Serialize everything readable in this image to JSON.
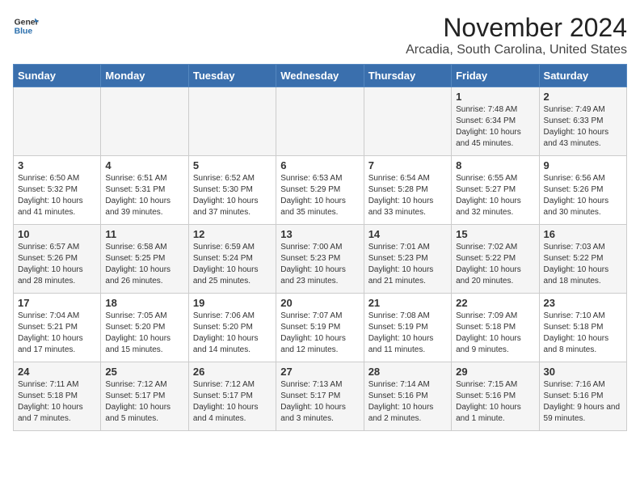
{
  "logo": {
    "line1": "General",
    "line2": "Blue"
  },
  "title": "November 2024",
  "location": "Arcadia, South Carolina, United States",
  "weekdays": [
    "Sunday",
    "Monday",
    "Tuesday",
    "Wednesday",
    "Thursday",
    "Friday",
    "Saturday"
  ],
  "weeks": [
    [
      {
        "day": "",
        "info": ""
      },
      {
        "day": "",
        "info": ""
      },
      {
        "day": "",
        "info": ""
      },
      {
        "day": "",
        "info": ""
      },
      {
        "day": "",
        "info": ""
      },
      {
        "day": "1",
        "info": "Sunrise: 7:48 AM\nSunset: 6:34 PM\nDaylight: 10 hours and 45 minutes."
      },
      {
        "day": "2",
        "info": "Sunrise: 7:49 AM\nSunset: 6:33 PM\nDaylight: 10 hours and 43 minutes."
      }
    ],
    [
      {
        "day": "3",
        "info": "Sunrise: 6:50 AM\nSunset: 5:32 PM\nDaylight: 10 hours and 41 minutes."
      },
      {
        "day": "4",
        "info": "Sunrise: 6:51 AM\nSunset: 5:31 PM\nDaylight: 10 hours and 39 minutes."
      },
      {
        "day": "5",
        "info": "Sunrise: 6:52 AM\nSunset: 5:30 PM\nDaylight: 10 hours and 37 minutes."
      },
      {
        "day": "6",
        "info": "Sunrise: 6:53 AM\nSunset: 5:29 PM\nDaylight: 10 hours and 35 minutes."
      },
      {
        "day": "7",
        "info": "Sunrise: 6:54 AM\nSunset: 5:28 PM\nDaylight: 10 hours and 33 minutes."
      },
      {
        "day": "8",
        "info": "Sunrise: 6:55 AM\nSunset: 5:27 PM\nDaylight: 10 hours and 32 minutes."
      },
      {
        "day": "9",
        "info": "Sunrise: 6:56 AM\nSunset: 5:26 PM\nDaylight: 10 hours and 30 minutes."
      }
    ],
    [
      {
        "day": "10",
        "info": "Sunrise: 6:57 AM\nSunset: 5:26 PM\nDaylight: 10 hours and 28 minutes."
      },
      {
        "day": "11",
        "info": "Sunrise: 6:58 AM\nSunset: 5:25 PM\nDaylight: 10 hours and 26 minutes."
      },
      {
        "day": "12",
        "info": "Sunrise: 6:59 AM\nSunset: 5:24 PM\nDaylight: 10 hours and 25 minutes."
      },
      {
        "day": "13",
        "info": "Sunrise: 7:00 AM\nSunset: 5:23 PM\nDaylight: 10 hours and 23 minutes."
      },
      {
        "day": "14",
        "info": "Sunrise: 7:01 AM\nSunset: 5:23 PM\nDaylight: 10 hours and 21 minutes."
      },
      {
        "day": "15",
        "info": "Sunrise: 7:02 AM\nSunset: 5:22 PM\nDaylight: 10 hours and 20 minutes."
      },
      {
        "day": "16",
        "info": "Sunrise: 7:03 AM\nSunset: 5:22 PM\nDaylight: 10 hours and 18 minutes."
      }
    ],
    [
      {
        "day": "17",
        "info": "Sunrise: 7:04 AM\nSunset: 5:21 PM\nDaylight: 10 hours and 17 minutes."
      },
      {
        "day": "18",
        "info": "Sunrise: 7:05 AM\nSunset: 5:20 PM\nDaylight: 10 hours and 15 minutes."
      },
      {
        "day": "19",
        "info": "Sunrise: 7:06 AM\nSunset: 5:20 PM\nDaylight: 10 hours and 14 minutes."
      },
      {
        "day": "20",
        "info": "Sunrise: 7:07 AM\nSunset: 5:19 PM\nDaylight: 10 hours and 12 minutes."
      },
      {
        "day": "21",
        "info": "Sunrise: 7:08 AM\nSunset: 5:19 PM\nDaylight: 10 hours and 11 minutes."
      },
      {
        "day": "22",
        "info": "Sunrise: 7:09 AM\nSunset: 5:18 PM\nDaylight: 10 hours and 9 minutes."
      },
      {
        "day": "23",
        "info": "Sunrise: 7:10 AM\nSunset: 5:18 PM\nDaylight: 10 hours and 8 minutes."
      }
    ],
    [
      {
        "day": "24",
        "info": "Sunrise: 7:11 AM\nSunset: 5:18 PM\nDaylight: 10 hours and 7 minutes."
      },
      {
        "day": "25",
        "info": "Sunrise: 7:12 AM\nSunset: 5:17 PM\nDaylight: 10 hours and 5 minutes."
      },
      {
        "day": "26",
        "info": "Sunrise: 7:12 AM\nSunset: 5:17 PM\nDaylight: 10 hours and 4 minutes."
      },
      {
        "day": "27",
        "info": "Sunrise: 7:13 AM\nSunset: 5:17 PM\nDaylight: 10 hours and 3 minutes."
      },
      {
        "day": "28",
        "info": "Sunrise: 7:14 AM\nSunset: 5:16 PM\nDaylight: 10 hours and 2 minutes."
      },
      {
        "day": "29",
        "info": "Sunrise: 7:15 AM\nSunset: 5:16 PM\nDaylight: 10 hours and 1 minute."
      },
      {
        "day": "30",
        "info": "Sunrise: 7:16 AM\nSunset: 5:16 PM\nDaylight: 9 hours and 59 minutes."
      }
    ]
  ]
}
